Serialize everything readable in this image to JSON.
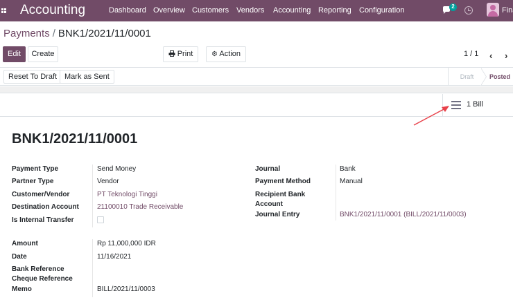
{
  "navbar": {
    "app_name": "Accounting",
    "menu": [
      "Dashboard",
      "Overview",
      "Customers",
      "Vendors",
      "Accounting",
      "Reporting",
      "Configuration"
    ],
    "chat_count": "2",
    "user_name": "Fina"
  },
  "breadcrumb": {
    "parent": "Payments",
    "separator": "/",
    "current": "BNK1/2021/11/0001"
  },
  "toolbar": {
    "edit_label": "Edit",
    "create_label": "Create",
    "print_label": "Print",
    "action_label": "Action"
  },
  "pager": {
    "value": "1 / 1"
  },
  "statusbar": {
    "reset_label": "Reset To Draft",
    "mark_sent_label": "Mark as Sent",
    "stages": [
      "Draft",
      "Posted"
    ],
    "active_stage": "Posted"
  },
  "smart_button": {
    "label": "1 Bill"
  },
  "form": {
    "title": "BNK1/2021/11/0001",
    "left_fields": [
      {
        "label": "Payment Type",
        "value": "Send Money"
      },
      {
        "label": "Partner Type",
        "value": "Vendor"
      },
      {
        "label": "Customer/Vendor",
        "value": "PT Teknologi Tinggi"
      },
      {
        "label": "Destination Account",
        "value": "21100010 Trade Receivable"
      },
      {
        "label": "Is Internal Transfer",
        "value": ""
      }
    ],
    "left_fields_2": [
      {
        "label": "Amount",
        "value": "Rp 11,000,000 IDR"
      },
      {
        "label": "Date",
        "value": "11/16/2021"
      },
      {
        "label": "Bank Reference",
        "value": ""
      },
      {
        "label": "Cheque Reference",
        "value": ""
      },
      {
        "label": "Memo",
        "value": "BILL/2021/11/0003"
      }
    ],
    "right_fields": [
      {
        "label": "Journal",
        "value": "Bank"
      },
      {
        "label": "Payment Method",
        "value": "Manual"
      },
      {
        "label": "Recipient Bank Account",
        "label_line1": "Recipient Bank",
        "label_line2": "Account",
        "value": ""
      },
      {
        "label": "Journal Entry",
        "value": "BNK1/2021/11/0001 (BILL/2021/11/0003)"
      }
    ]
  },
  "colors": {
    "brand": "#714b67",
    "badge": "#00a09d",
    "annotation_arrow": "#e8414a"
  }
}
